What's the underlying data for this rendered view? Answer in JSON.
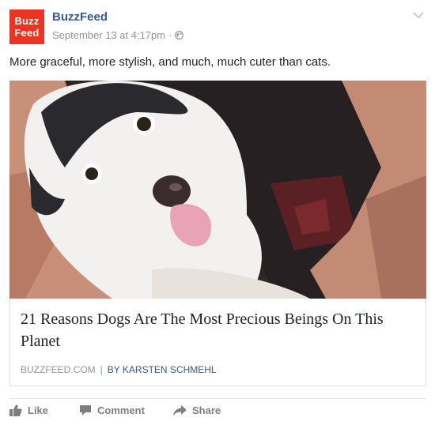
{
  "post": {
    "logo_line1": "Buzz",
    "logo_line2": "Feed",
    "page_name": "BuzzFeed",
    "timestamp": "September 13 at 4:17pm",
    "dot": "·",
    "caption": "More graceful, more stylish, and much, much cuter than cats."
  },
  "link_card": {
    "headline": "21 Reasons Dogs Are The Most Precious Beings On This Planet",
    "source": "BUZZFEED.COM",
    "separator": "|",
    "author": "BY KARSTEN SCHMEHL"
  },
  "actions": {
    "like": "Like",
    "comment": "Comment",
    "share": "Share"
  },
  "colors": {
    "brand_red": "#ee3322",
    "link_blue": "#365899",
    "meta_gray": "#90949c",
    "action_gray": "#7f7f7f"
  },
  "icons": [
    "globe-icon",
    "chevron-down-icon",
    "like-icon",
    "comment-icon",
    "share-icon"
  ]
}
